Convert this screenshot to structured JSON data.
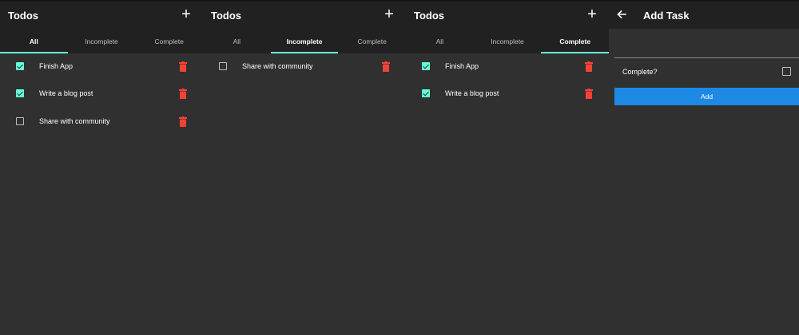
{
  "colors": {
    "background": "#303030",
    "appbar": "#212121",
    "accent": "#64ffda",
    "delete": "#f44336",
    "button": "#1e88e5"
  },
  "icons": {
    "add": "+",
    "trash": "trash-icon",
    "back": "arrow-back-icon"
  },
  "screens": [
    {
      "title": "Todos",
      "tabs": [
        "All",
        "Incomplete",
        "Complete"
      ],
      "active_tab": "All",
      "items": [
        {
          "text": "Finish App",
          "checked": true
        },
        {
          "text": "Write a blog post",
          "checked": true
        },
        {
          "text": "Share with community",
          "checked": false
        }
      ]
    },
    {
      "title": "Todos",
      "tabs": [
        "All",
        "Incomplete",
        "Complete"
      ],
      "active_tab": "Incomplete",
      "items": [
        {
          "text": "Share with community",
          "checked": false
        }
      ]
    },
    {
      "title": "Todos",
      "tabs": [
        "All",
        "Incomplete",
        "Complete"
      ],
      "active_tab": "Complete",
      "items": [
        {
          "text": "Finish App",
          "checked": true
        },
        {
          "text": "Write a blog post",
          "checked": true
        }
      ]
    }
  ],
  "add_task": {
    "title": "Add Task",
    "task_value": "",
    "complete_label": "Complete?",
    "complete_checked": false,
    "button_label": "Add"
  }
}
